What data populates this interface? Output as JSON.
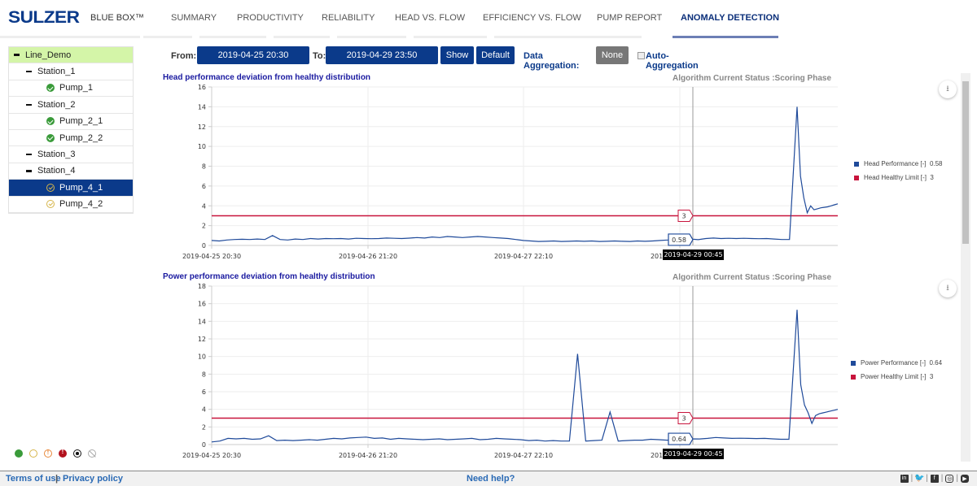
{
  "header": {
    "logo": "SULZER",
    "brand": "BLUE BOX™",
    "tabs": [
      {
        "label": "SUMMARY",
        "active": false
      },
      {
        "label": "PRODUCTIVITY",
        "active": false
      },
      {
        "label": "RELIABILITY",
        "active": false
      },
      {
        "label": "HEAD VS. FLOW",
        "active": false
      },
      {
        "label": "EFFICIENCY VS. FLOW",
        "active": false
      },
      {
        "label": "PUMP REPORT",
        "active": false
      },
      {
        "label": "ANOMALY DETECTION",
        "active": true
      }
    ]
  },
  "sidebar": {
    "tree": [
      {
        "label": "Line_Demo",
        "level": 0,
        "type": "group",
        "root": true
      },
      {
        "label": "Station_1",
        "level": 1,
        "type": "group"
      },
      {
        "label": "Pump_1",
        "level": 2,
        "type": "pump",
        "status": "ok"
      },
      {
        "label": "Station_2",
        "level": 1,
        "type": "group"
      },
      {
        "label": "Pump_2_1",
        "level": 2,
        "type": "pump",
        "status": "ok"
      },
      {
        "label": "Pump_2_2",
        "level": 2,
        "type": "pump",
        "status": "ok"
      },
      {
        "label": "Station_3",
        "level": 1,
        "type": "group"
      },
      {
        "label": "Station_4",
        "level": 1,
        "type": "group"
      },
      {
        "label": "Pump_4_1",
        "level": 2,
        "type": "pump",
        "status": "warn",
        "selected": true
      },
      {
        "label": "Pump_4_2",
        "level": 2,
        "type": "pump",
        "status": "warn"
      }
    ],
    "status_legend": [
      "ok-icon",
      "warning-check-icon",
      "alert-icon",
      "critical-icon",
      "stopped-icon",
      "disabled-icon"
    ]
  },
  "controls": {
    "from_label": "From:",
    "from_value": "2019-04-25 20:30",
    "to_label": "To:",
    "to_value": "2019-04-29 23:50",
    "show_label": "Show",
    "default_label": "Default",
    "aggregation_label": "Data Aggregation:",
    "aggregation_value": "None",
    "auto_aggregation_label": "Auto-Aggregation",
    "auto_aggregation_checked": false
  },
  "colors": {
    "primary": "#0b3a8a",
    "series": "#1f4a9a",
    "limit": "#c8143c",
    "active_tab_underline": "#6c7fb5",
    "root_bg": "#d4f5a8"
  },
  "chart_data": [
    {
      "type": "line",
      "title": "Head performance deviation from healthy distribution",
      "status": "Algorithm Current Status :Scoring Phase",
      "ylim": [
        0,
        16
      ],
      "yticks": [
        0,
        2,
        4,
        6,
        8,
        10,
        12,
        14,
        16
      ],
      "xticks": [
        "2019-04-25 20:30",
        "2019-04-26 21:20",
        "2019-04-27 22:10",
        "2019-04-28 23:00"
      ],
      "grid": true,
      "legend_position": "right",
      "series": [
        {
          "name": "Head Performance [-]",
          "current": "0.58",
          "color": "#1f4a9a",
          "values": [
            0.5,
            0.45,
            0.55,
            0.6,
            0.62,
            0.6,
            0.65,
            0.6,
            1.0,
            0.6,
            0.55,
            0.65,
            0.6,
            0.7,
            0.65,
            0.7,
            0.68,
            0.7,
            0.65,
            0.72,
            0.7,
            0.68,
            0.7,
            0.75,
            0.72,
            0.7,
            0.74,
            0.8,
            0.75,
            0.85,
            0.8,
            0.9,
            0.85,
            0.8,
            0.85,
            0.9,
            0.85,
            0.8,
            0.75,
            0.7,
            0.6,
            0.5,
            0.45,
            0.4,
            0.42,
            0.45,
            0.4,
            0.42,
            0.45,
            0.42,
            0.45,
            0.4,
            0.42,
            0.45,
            0.42,
            0.4,
            0.45,
            0.42,
            0.45,
            0.5,
            0.55,
            0.65,
            0.7,
            0.65,
            0.58,
            0.7,
            0.75,
            0.7,
            0.72,
            0.7,
            0.72,
            0.7,
            0.68,
            0.7,
            0.65,
            0.6,
            0.6,
            14.0,
            7.0,
            4.8,
            3.3,
            4.0,
            3.6,
            3.7,
            3.8,
            3.85,
            3.9,
            4.0,
            4.1,
            4.2
          ]
        },
        {
          "name": "Head Healthy Limit [-]",
          "current": "3",
          "color": "#c8143c",
          "values": [
            3
          ]
        }
      ],
      "crosshair": {
        "x_label": "2019-04-29 00:45",
        "series_value": "0.58",
        "limit_value": "3"
      }
    },
    {
      "type": "line",
      "title": "Power performance deviation from healthy distribution",
      "status": "Algorithm Current Status :Scoring Phase",
      "ylim": [
        0,
        18
      ],
      "yticks": [
        0,
        2,
        4,
        6,
        8,
        10,
        12,
        14,
        16,
        18
      ],
      "xticks": [
        "2019-04-25 20:30",
        "2019-04-26 21:20",
        "2019-04-27 22:10",
        "2019-04-28 23:00"
      ],
      "grid": true,
      "legend_position": "right",
      "series": [
        {
          "name": "Power Performance [-]",
          "current": "0.64",
          "color": "#1f4a9a",
          "values": [
            0.3,
            0.4,
            0.7,
            0.65,
            0.7,
            0.6,
            0.65,
            1.0,
            0.45,
            0.5,
            0.45,
            0.5,
            0.55,
            0.5,
            0.6,
            0.7,
            0.65,
            0.75,
            0.8,
            0.85,
            0.7,
            0.75,
            0.6,
            0.7,
            0.65,
            0.6,
            0.55,
            0.6,
            0.65,
            0.55,
            0.6,
            0.65,
            0.7,
            0.55,
            0.6,
            0.7,
            0.65,
            0.6,
            0.55,
            0.45,
            0.5,
            0.4,
            0.45,
            0.4,
            0.4,
            10.3,
            0.4,
            0.45,
            0.5,
            3.7,
            0.4,
            0.45,
            0.5,
            0.5,
            0.6,
            0.55,
            0.5,
            0.55,
            0.6,
            0.65,
            0.64,
            0.7,
            0.8,
            0.75,
            0.7,
            0.72,
            0.7,
            0.68,
            0.7,
            0.65,
            0.6,
            0.6,
            15.3,
            6.8,
            4.5,
            3.6,
            2.4,
            3.3,
            3.5,
            3.6,
            3.7,
            3.8,
            3.9,
            4.0
          ]
        },
        {
          "name": "Power Healthy Limit [-]",
          "current": "3",
          "color": "#c8143c",
          "values": [
            3
          ]
        }
      ],
      "crosshair": {
        "x_label": "2019-04-29 00:45",
        "series_value": "0.64",
        "limit_value": "3"
      }
    }
  ],
  "footer": {
    "terms": "Terms of use",
    "separator": "|",
    "privacy": "Privacy policy",
    "help": "Need help?",
    "social": [
      "linkedin-icon",
      "twitter-icon",
      "facebook-icon",
      "instagram-icon",
      "youtube-icon"
    ]
  }
}
